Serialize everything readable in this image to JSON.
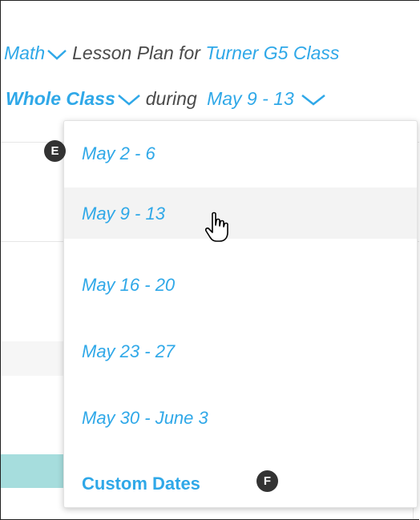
{
  "header": {
    "subject": "Math",
    "lesson_plan_for": "Lesson Plan for",
    "class_name": "Turner G5 Class",
    "group": "Whole Class",
    "during": "during",
    "date_range": "May 9 - 13"
  },
  "dropdown": {
    "options": [
      {
        "label": "May 2 - 6"
      },
      {
        "label": "May 9 - 13",
        "hovered": true
      },
      {
        "label": "May 16 - 20"
      },
      {
        "label": "May 23 - 27"
      },
      {
        "label": "May 30 - June 3"
      },
      {
        "label": "Custom Dates"
      }
    ]
  },
  "annotations": {
    "badge_e": "E",
    "badge_f": "F"
  },
  "colors": {
    "link_blue": "#2fa8e8",
    "hover_bg": "#f3f3f3",
    "teal_bar": "#a6dddd",
    "badge_bg": "#333333"
  },
  "icons": {
    "chevron": "chevron-down-icon",
    "cursor": "hand-pointer-icon"
  }
}
